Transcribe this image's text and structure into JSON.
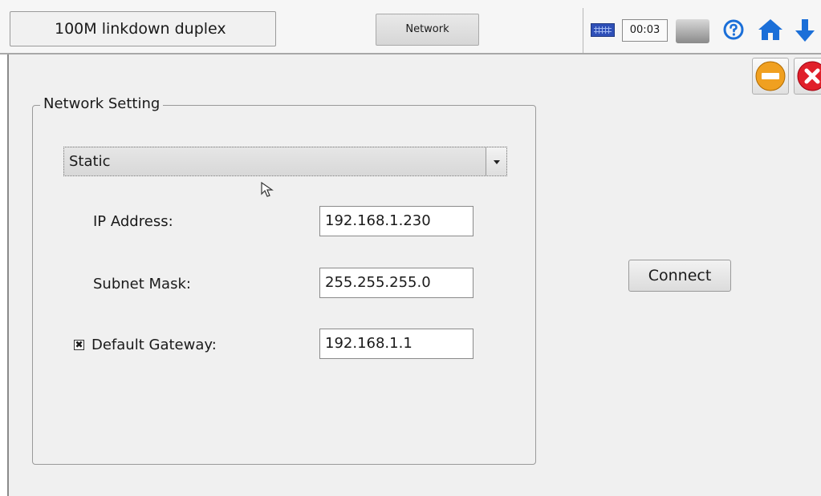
{
  "header": {
    "status_text": "100M linkdown duplex",
    "network_tab_label": "Network",
    "timer": "00:03",
    "icons": [
      "keyboard-icon",
      "battery-icon",
      "help-icon",
      "home-icon",
      "arrow-down-icon"
    ]
  },
  "window_controls": {
    "minimize_icon": "minus-circle-icon",
    "close_icon": "close-circle-icon"
  },
  "network_setting": {
    "title": "Network Setting",
    "mode": "Static",
    "ip_label": "IP Address:",
    "ip_value": "192.168.1.230",
    "subnet_label": "Subnet Mask:",
    "subnet_value": "255.255.255.0",
    "gateway_label": "Default Gateway:",
    "gateway_checked_mark": "✖",
    "gateway_value": "192.168.1.1"
  },
  "actions": {
    "connect_label": "Connect"
  },
  "colors": {
    "accent_blue": "#1b6fd8",
    "minimize_orange": "#f0a020",
    "close_red": "#e0202a"
  }
}
